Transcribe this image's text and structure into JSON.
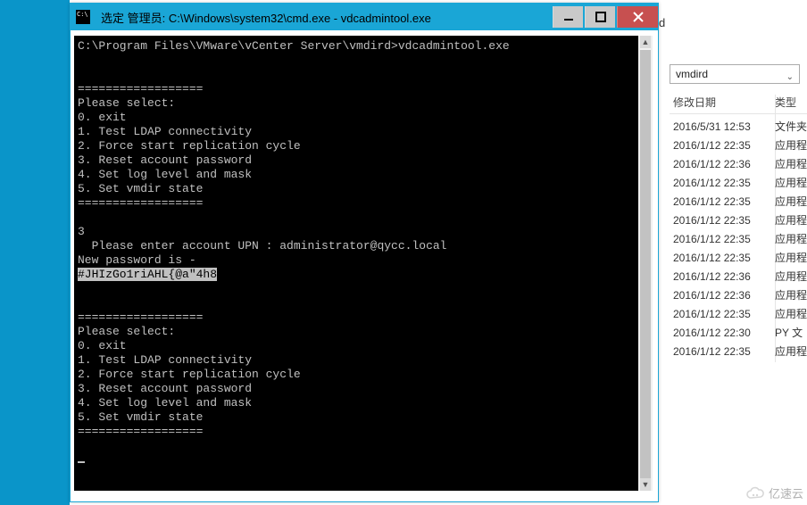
{
  "cmd": {
    "title": "选定 管理员: C:\\Windows\\system32\\cmd.exe - vdcadmintool.exe",
    "prompt_line": "C:\\Program Files\\VMware\\vCenter Server\\vmdird>vdcadmintool.exe",
    "hr": "==================",
    "menu_header": "Please select:",
    "menu": [
      "0. exit",
      "1. Test LDAP connectivity",
      "2. Force start replication cycle",
      "3. Reset account password",
      "4. Set log level and mask",
      "5. Set vmdir state"
    ],
    "choice": "3",
    "upn_prompt": "  Please enter account UPN : administrator@qycc.local",
    "newpass_label": "New password is -",
    "newpass_value": "#JHIzGo1riAHL{@a\"4h8"
  },
  "explorer": {
    "breadcrumb_tail": "d",
    "search_value": "vmdird",
    "col_date": "修改日期",
    "col_type": "类型",
    "rows": [
      {
        "date": "2016/5/31 12:53",
        "type": "文件夹"
      },
      {
        "date": "2016/1/12 22:35",
        "type": "应用程"
      },
      {
        "date": "2016/1/12 22:36",
        "type": "应用程"
      },
      {
        "date": "2016/1/12 22:35",
        "type": "应用程"
      },
      {
        "date": "2016/1/12 22:35",
        "type": "应用程"
      },
      {
        "date": "2016/1/12 22:35",
        "type": "应用程"
      },
      {
        "date": "2016/1/12 22:35",
        "type": "应用程"
      },
      {
        "date": "2016/1/12 22:35",
        "type": "应用程"
      },
      {
        "date": "2016/1/12 22:36",
        "type": "应用程"
      },
      {
        "date": "2016/1/12 22:36",
        "type": "应用程"
      },
      {
        "date": "2016/1/12 22:35",
        "type": "应用程"
      },
      {
        "date": "2016/1/12 22:30",
        "type": "PY 文"
      },
      {
        "date": "2016/1/12 22:35",
        "type": "应用程"
      }
    ]
  },
  "watermark": "亿速云"
}
